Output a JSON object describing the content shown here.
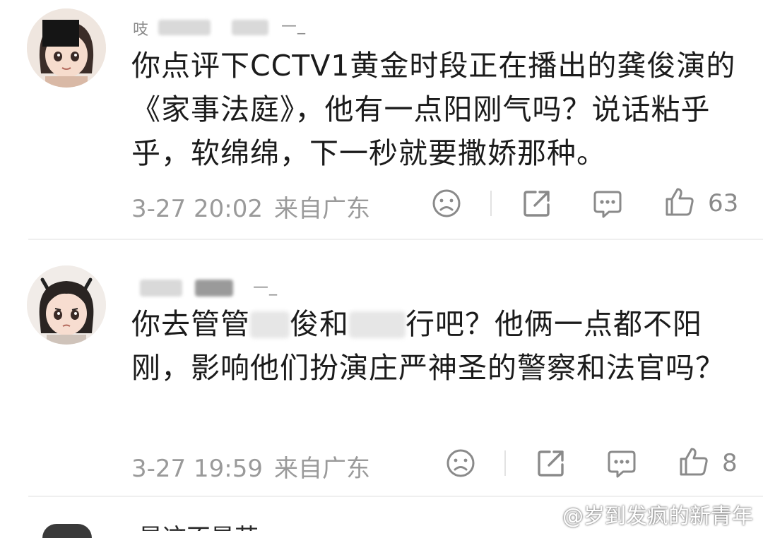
{
  "comments": [
    {
      "name_fragment": "吱",
      "name_suffix": "—_",
      "text": "你点评下CCTV1黄金时段正在播出的龚俊演的《家事法庭》，他有一点阳刚气吗？说话粘乎乎，软绵绵，下一秒就要撒娇那种。",
      "time": "3-27 20:02",
      "location": "来自广东",
      "likes": "63"
    },
    {
      "name_suffix": "—_",
      "text_part1": "你去管管",
      "text_part2": "俊和",
      "text_part3": "行吧？他俩一点都不阳刚，影响他们扮演庄严神圣的警察和法官吗？",
      "time": "3-27 19:59",
      "location": "来自广东",
      "likes": "8"
    }
  ],
  "next_comment_peek": "星这不是苏",
  "watermark": "@岁到发疯的新青年",
  "icons": [
    "sad-face-icon",
    "share-icon",
    "comment-icon",
    "thumbs-up-icon"
  ],
  "colors": {
    "meta": "#9a9a9a",
    "text": "#1b1b1b",
    "divider": "#efefef"
  }
}
